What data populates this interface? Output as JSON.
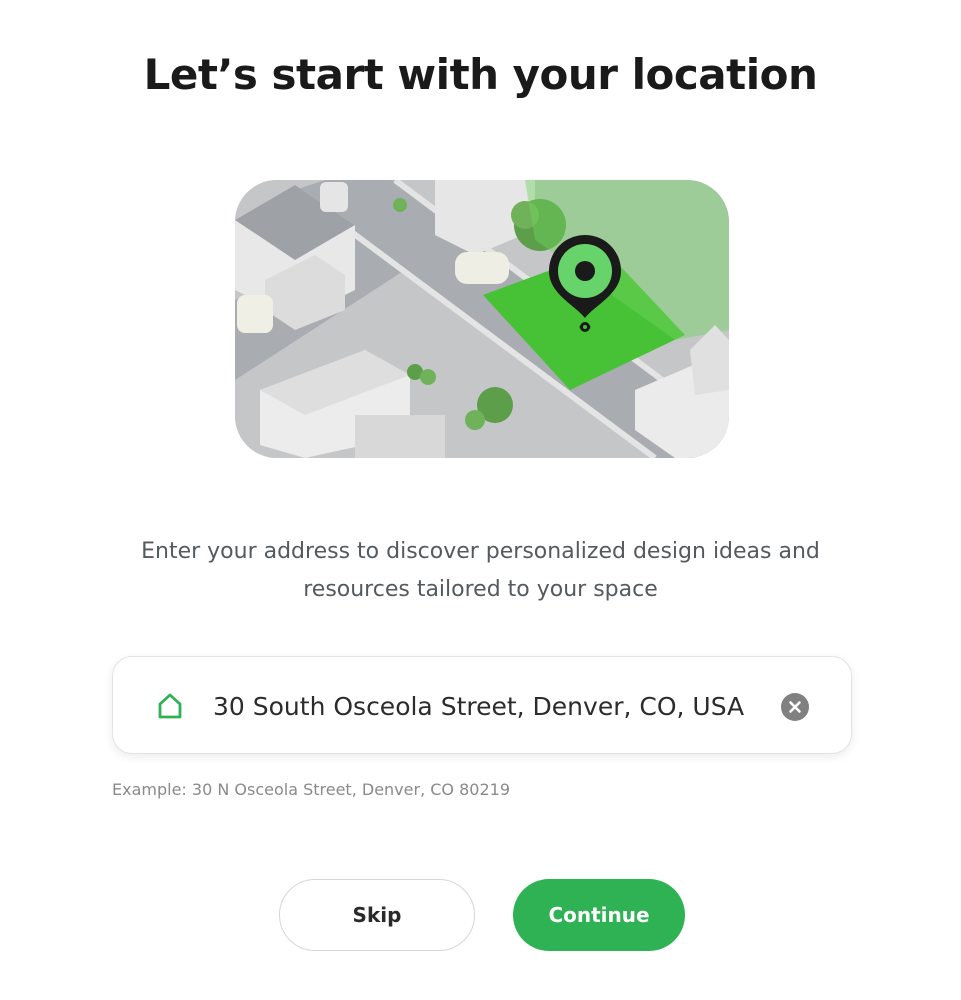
{
  "page": {
    "title": "Let’s start with your location",
    "subtitle": "Enter your address to discover personalized design ideas and resources tailored to your space"
  },
  "address": {
    "value": "30 South Osceola Street, Denver, CO, USA",
    "icon": "home-icon",
    "clear_icon": "clear-icon",
    "example": "Example: 30 N Osceola Street, Denver, CO 80219"
  },
  "buttons": {
    "skip_label": "Skip",
    "continue_label": "Continue"
  },
  "colors": {
    "accent": "#2eb254",
    "highlight_lot": "#47c236",
    "pin": "#1a1a1a"
  }
}
